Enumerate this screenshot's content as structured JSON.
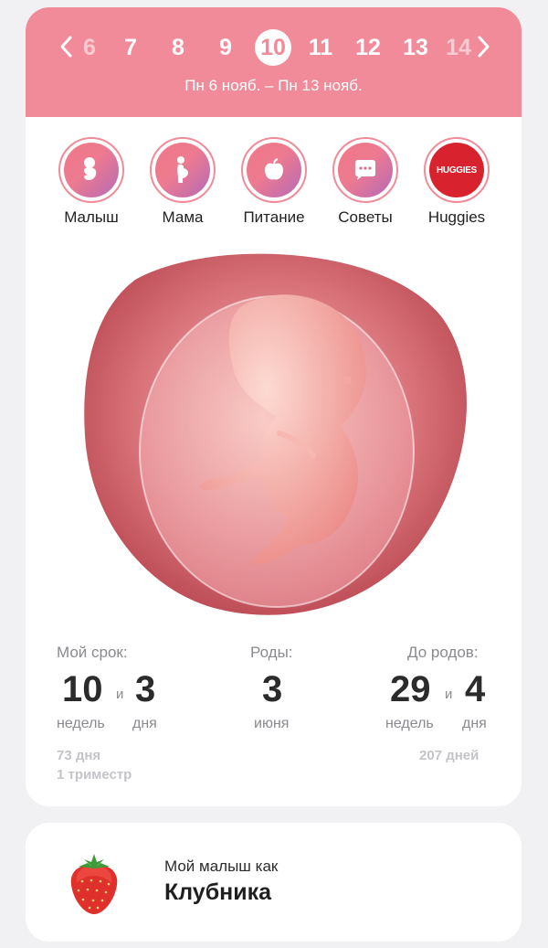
{
  "weeks": {
    "prev_label": "‹",
    "items": [
      "6",
      "7",
      "8",
      "9",
      "10",
      "11",
      "12",
      "13",
      "14"
    ],
    "current": "10",
    "date_range": "Пн 6 нояб. – Пн 13 нояб."
  },
  "categories": [
    {
      "label": "Малыш",
      "icon": "baby-icon"
    },
    {
      "label": "Мама",
      "icon": "pregnant-woman-icon"
    },
    {
      "label": "Питание",
      "icon": "apple-icon"
    },
    {
      "label": "Советы",
      "icon": "chat-bubble-icon"
    },
    {
      "label": "Huggies",
      "icon": "huggies-logo",
      "logo_text": "HUGGIES"
    }
  ],
  "stats": {
    "term": {
      "label": "Мой срок:",
      "weeks": "10",
      "conj": "и",
      "days": "3",
      "weeks_unit": "недель",
      "days_unit": "дня",
      "total_days": "73 дня",
      "trimester": "1 триместр"
    },
    "birth": {
      "label": "Роды:",
      "day": "3",
      "month": "июня"
    },
    "remaining": {
      "label": "До родов:",
      "weeks": "29",
      "conj": "и",
      "days": "4",
      "weeks_unit": "недель",
      "days_unit": "дня",
      "total_days": "207 дней"
    }
  },
  "fruit": {
    "pre": "Мой малыш как",
    "name": "Клубника",
    "icon": "strawberry-icon"
  },
  "colors": {
    "accent": "#f28b99",
    "background": "#f1f1f3",
    "huggies_red": "#d8232f"
  }
}
